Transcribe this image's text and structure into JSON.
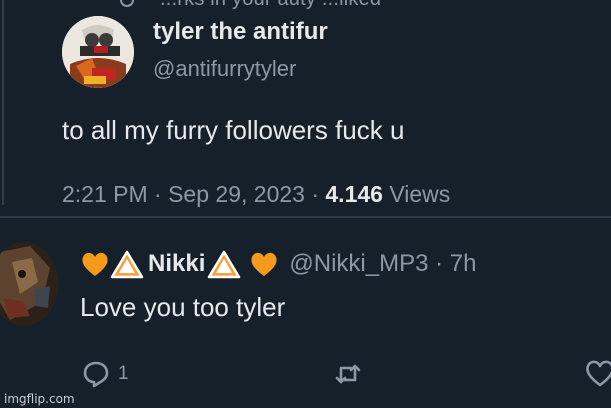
{
  "top_fragment": "...rks in your auty ...liked",
  "quoted_tweet": {
    "display_name": "tyler the antifur",
    "handle": "@antifurrytyler",
    "text": "to all my furry followers fuck u",
    "time_date": "2:21 PM · Sep 29, 2023 · ",
    "views_count": "4.146",
    "views_label": " Views"
  },
  "reply": {
    "display_name": "Nikki",
    "handle_time": "@Nikki_MP3 · 7h",
    "text": "Love you too tyler",
    "reply_count": "1"
  },
  "watermark": "imgflip.com",
  "colors": {
    "background": "#16202a",
    "heart": "#f59b1c",
    "warning": "#f4a340",
    "secondary_text": "#8b98a5"
  },
  "icons": [
    "reply-icon",
    "retweet-icon",
    "like-icon",
    "heart-emoji-icon",
    "warning-emoji-icon"
  ]
}
